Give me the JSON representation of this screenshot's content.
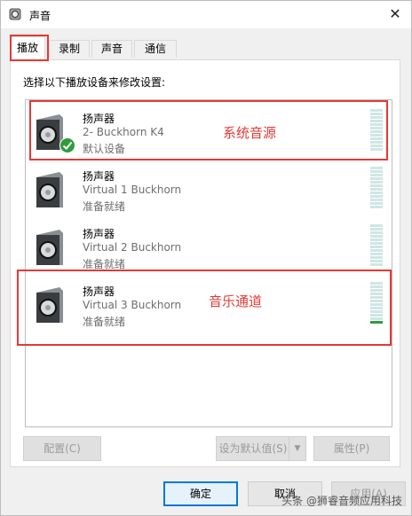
{
  "window": {
    "title": "声音",
    "close_label": "✕"
  },
  "tabs": [
    {
      "label": "播放"
    },
    {
      "label": "录制"
    },
    {
      "label": "声音"
    },
    {
      "label": "通信"
    }
  ],
  "panel": {
    "instruction": "选择以下播放设备来修改设置:"
  },
  "devices": [
    {
      "name": "扬声器",
      "subtitle": "2- Buckhorn K4",
      "status": "默认设备",
      "default": true
    },
    {
      "name": "扬声器",
      "subtitle": "Virtual 1 Buckhorn",
      "status": "准备就绪",
      "default": false
    },
    {
      "name": "扬声器",
      "subtitle": "Virtual 2 Buckhorn",
      "status": "准备就绪",
      "default": false
    },
    {
      "name": "扬声器",
      "subtitle": "Virtual 3 Buckhorn",
      "status": "准备就绪",
      "default": false
    }
  ],
  "annotations": {
    "system_source": "系统音源",
    "music_channel": "音乐通道"
  },
  "panel_buttons": {
    "configure": "配置(C)",
    "set_default": "设为默认值(S)",
    "properties": "属性(P)"
  },
  "dialog_buttons": {
    "ok": "确定",
    "cancel": "取消",
    "apply": "应用(A)"
  },
  "watermark": "头条 @狮睿音频应用科技",
  "colors": {
    "annotation_red": "#e53935",
    "accent_blue": "#0078d7",
    "meter_idle": "#cfe6e5",
    "meter_active": "#2e9b3e"
  }
}
